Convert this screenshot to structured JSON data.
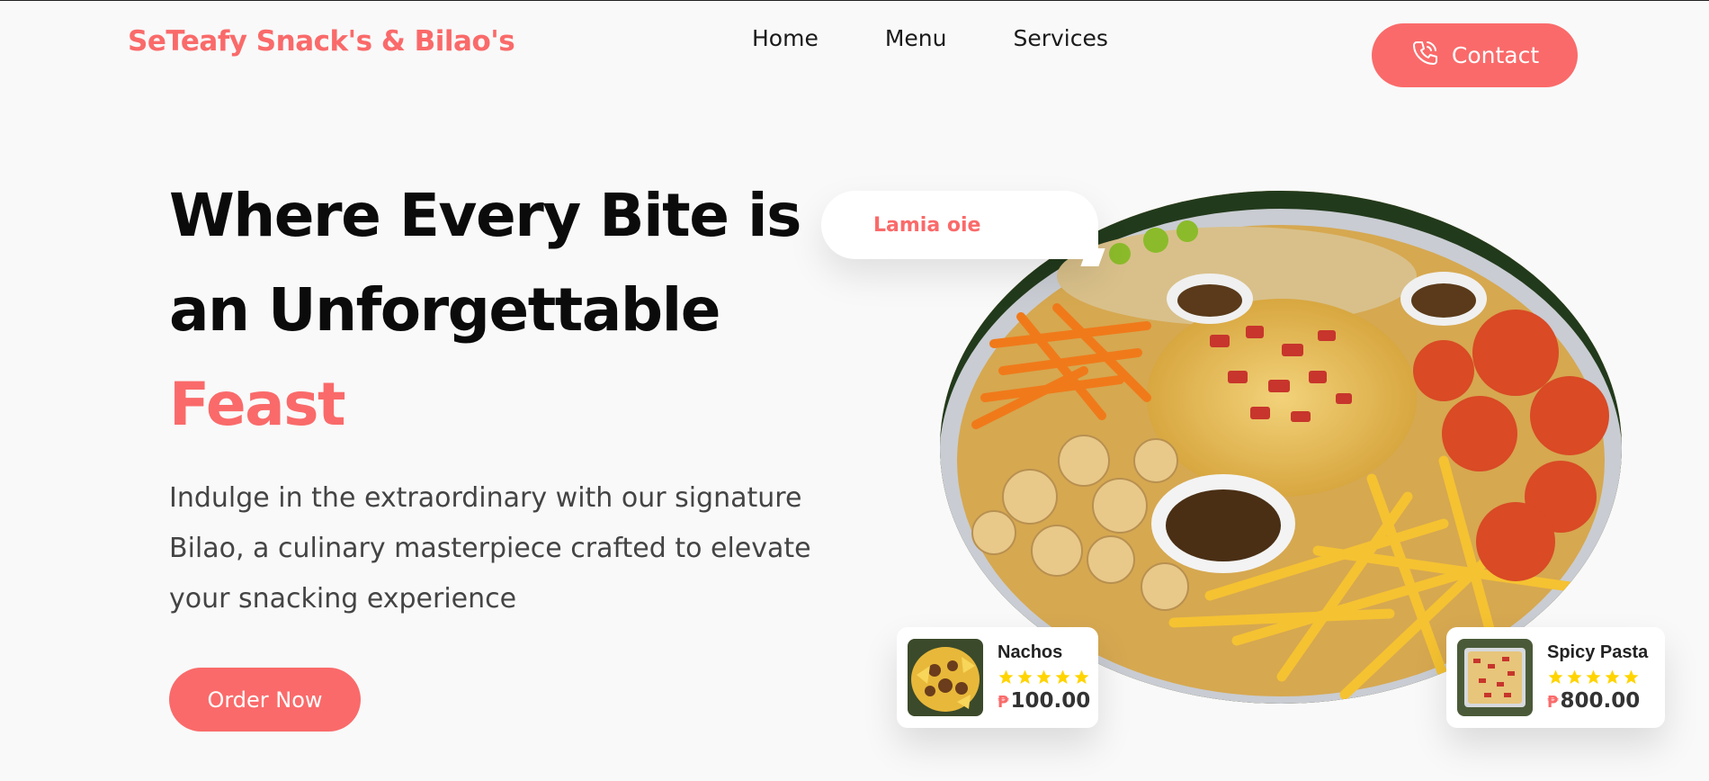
{
  "brand": {
    "name": "SeTeafy Snack's & Bilao's"
  },
  "nav": {
    "items": [
      "Home",
      "Menu",
      "Services"
    ]
  },
  "contact": {
    "label": "Contact",
    "icon": "phone-icon"
  },
  "hero": {
    "headline_line1": "Where Every Bite is",
    "headline_line2": "an Unforgettable",
    "headline_accent": "Feast",
    "description": "Indulge in the extraordinary with our signature Bilao, a culinary masterpiece crafted to elevate your snacking experience",
    "order_label": "Order Now"
  },
  "bubble": {
    "text": "Lamia oie"
  },
  "cards": [
    {
      "name": "Nachos",
      "rating": 5,
      "currency": "₱",
      "price": "100.00"
    },
    {
      "name": "Spicy Pasta",
      "rating": 5,
      "currency": "₱",
      "price": "800.00"
    }
  ],
  "colors": {
    "accent": "#fa6a6a",
    "star": "#ffd400",
    "background": "#f9f9f9"
  }
}
